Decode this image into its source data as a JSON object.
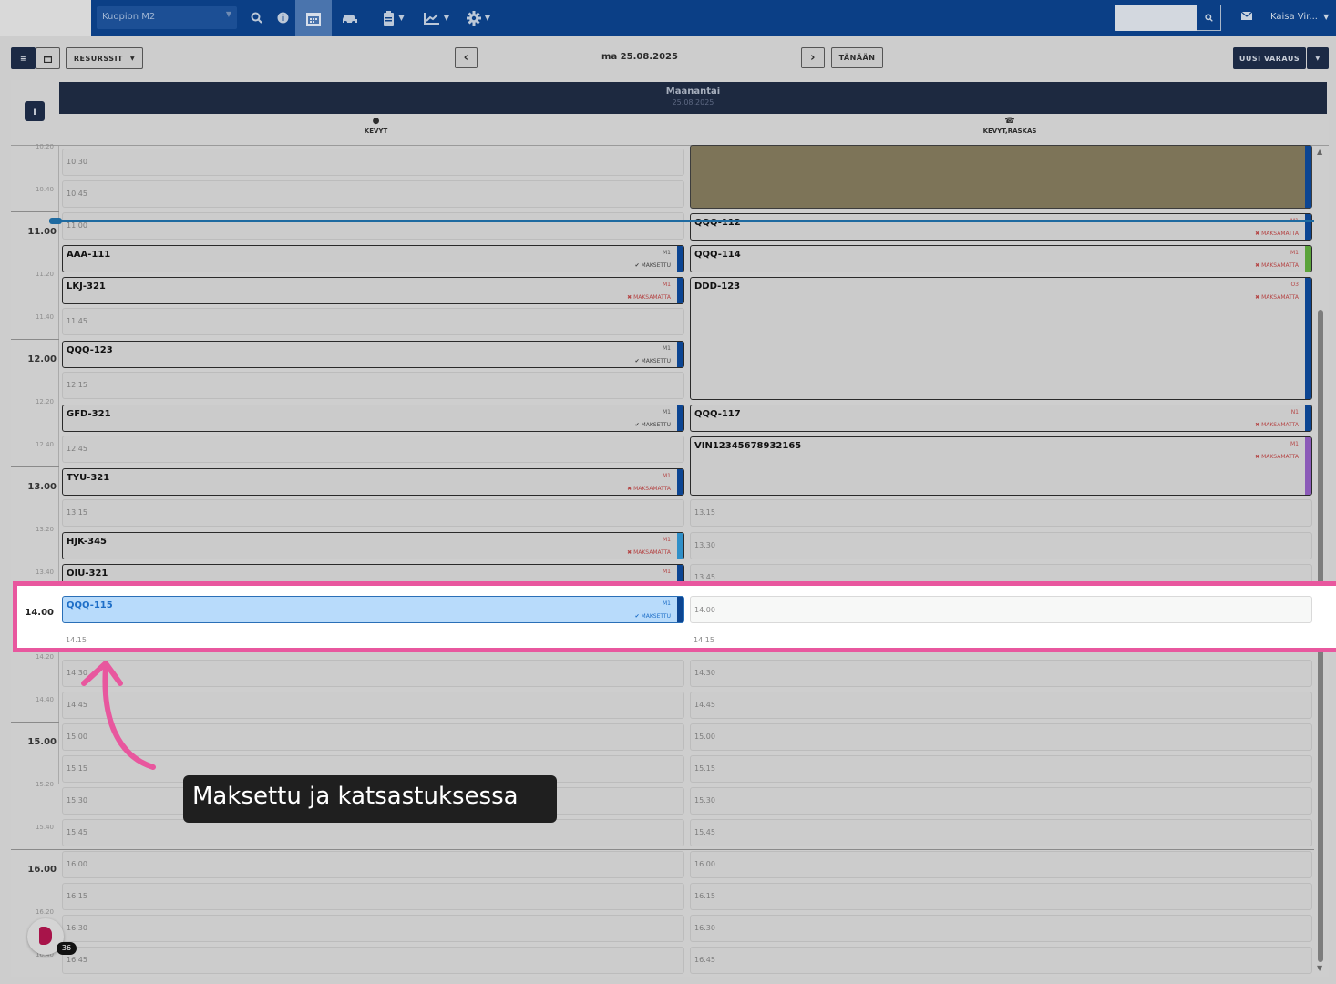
{
  "nav": {
    "location_select": "Kuopion M2",
    "user": "Kaisa Vir...",
    "icons": [
      "search-icon",
      "info-icon",
      "calendar-icon",
      "car-icon",
      "clipboard-icon",
      "chart-icon",
      "gear-icon",
      "mail-icon"
    ]
  },
  "toolbar": {
    "resources_label": "RESURSSIT",
    "prev": "‹",
    "date": "ma 25.08.2025",
    "next": "›",
    "today_label": "TÄNÄÄN",
    "new_reservation_label": "UUSI VARAUS"
  },
  "calendar": {
    "info_btn": "i",
    "day_name": "Maanantai",
    "day_date": "25.08.2025",
    "resources": [
      {
        "name": "KEVYT",
        "icon": "globe-icon"
      },
      {
        "name": "KEVYT,RASKAS",
        "icon": "phone-icon"
      }
    ],
    "hour_labels": [
      "11.00",
      "12.00",
      "13.00",
      "14.00",
      "15.00",
      "16.00"
    ],
    "sub_labels": [
      "10.20",
      "10.40",
      "11.20",
      "11.40",
      "12.20",
      "12.40",
      "13.20",
      "13.40",
      "14.20",
      "14.40",
      "15.20",
      "15.40",
      "16.20",
      "16.40"
    ],
    "col1_slots": [
      "10.30",
      "10.45",
      "11.00",
      "11.45",
      "12.15",
      "12.45",
      "13.15",
      "14.15",
      "14.30",
      "14.45",
      "15.00",
      "15.15",
      "15.30",
      "15.45",
      "16.00",
      "16.15",
      "16.30",
      "16.45"
    ],
    "col2_slots": [
      "13.15",
      "13.30",
      "13.45",
      "14.00",
      "14.15",
      "14.30",
      "14.45",
      "15.00",
      "15.15",
      "15.30",
      "15.45",
      "16.00",
      "16.15",
      "16.30",
      "16.45"
    ],
    "col1_bookings": [
      {
        "plate": "AAA-111",
        "code": "M1",
        "status": "✔ MAKSETTU",
        "paid": true,
        "bar": "#0c4592"
      },
      {
        "plate": "LKJ-321",
        "code": "M1",
        "status": "✖ MAKSAMATTA",
        "paid": false,
        "bar": "#0c4592"
      },
      {
        "plate": "QQQ-123",
        "code": "M1",
        "status": "✔ MAKSETTU",
        "paid": true,
        "bar": "#0c4592"
      },
      {
        "plate": "GFD-321",
        "code": "M1",
        "status": "✔ MAKSETTU",
        "paid": true,
        "bar": "#0c4592"
      },
      {
        "plate": "TYU-321",
        "code": "M1",
        "status": "✖ MAKSAMATTA",
        "paid": false,
        "bar": "#0c4592"
      },
      {
        "plate": "HJK-345",
        "code": "M1",
        "status": "✖ MAKSAMATTA",
        "paid": false,
        "bar": "#2f8fc8"
      },
      {
        "plate": "OIU-321",
        "code": "M1",
        "status": "✖ MAKSAMATTA",
        "paid": false,
        "bar": "#0c4592"
      }
    ],
    "col2_bookings": [
      {
        "plate": "QQQ-112",
        "code": "M1",
        "status": "✖ MAKSAMATTA",
        "bar": "#0c4592"
      },
      {
        "plate": "QQQ-114",
        "code": "M1",
        "status": "✖ MAKSAMATTA",
        "bar": "#5aa33a"
      },
      {
        "plate": "DDD-123",
        "code": "O3",
        "status": "✖ MAKSAMATTA",
        "bar": "#0c4592"
      },
      {
        "plate": "QQQ-117",
        "code": "N1",
        "status": "✖ MAKSAMATTA",
        "bar": "#0c4592"
      },
      {
        "plate": "VIN12345678932165",
        "code": "M1",
        "status": "✖ MAKSAMATTA",
        "bar": "#8b5ab8"
      }
    ],
    "highlight": {
      "hour": "14.00",
      "plate": "QQQ-115",
      "code": "M1",
      "status": "✔ MAKSETTU",
      "col2_slot": "14.00",
      "col1_sub": "14.15",
      "col2_sub": "14.15"
    }
  },
  "annotation": {
    "text": "Maksettu ja katsastuksessa"
  },
  "chat": {
    "badge": "36"
  },
  "colors": {
    "nav_bg": "#0b3f86",
    "highlight_border": "#e8579e",
    "highlight_booking": "#b8dbfb",
    "paid_blue": "#1d6ec7",
    "unpaid_red": "#b54545"
  }
}
